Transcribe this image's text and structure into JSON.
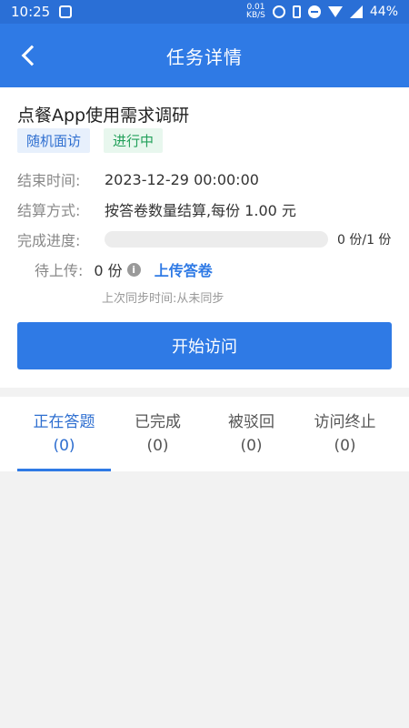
{
  "status_bar": {
    "time": "10:25",
    "net_speed_value": "0.01",
    "net_speed_unit": "KB/S",
    "battery": "44%"
  },
  "navbar": {
    "title": "任务详情"
  },
  "task": {
    "title": "点餐App使用需求调研",
    "tags": {
      "type": "随机面访",
      "status": "进行中"
    },
    "end_time_label": "结束时间:",
    "end_time_value": "2023-12-29 00:00:00",
    "settle_label": "结算方式:",
    "settle_value": "按答卷数量结算,每份 1.00 元",
    "progress_label": "完成进度:",
    "progress_fraction": 0,
    "progress_text": "0 份/1 份",
    "pending_label": "待上传:",
    "pending_value": "0 份",
    "upload_link": "上传答卷",
    "sync_text": "上次同步时间:从未同步",
    "start_button": "开始访问"
  },
  "tabs": [
    {
      "label": "正在答题",
      "count": "(0)",
      "active": true
    },
    {
      "label": "已完成",
      "count": "(0)",
      "active": false
    },
    {
      "label": "被驳回",
      "count": "(0)",
      "active": false
    },
    {
      "label": "访问终止",
      "count": "(0)",
      "active": false
    }
  ],
  "colors": {
    "primary": "#2f7ae5",
    "status_bar": "#2a6fd6",
    "success": "#22a05a"
  }
}
